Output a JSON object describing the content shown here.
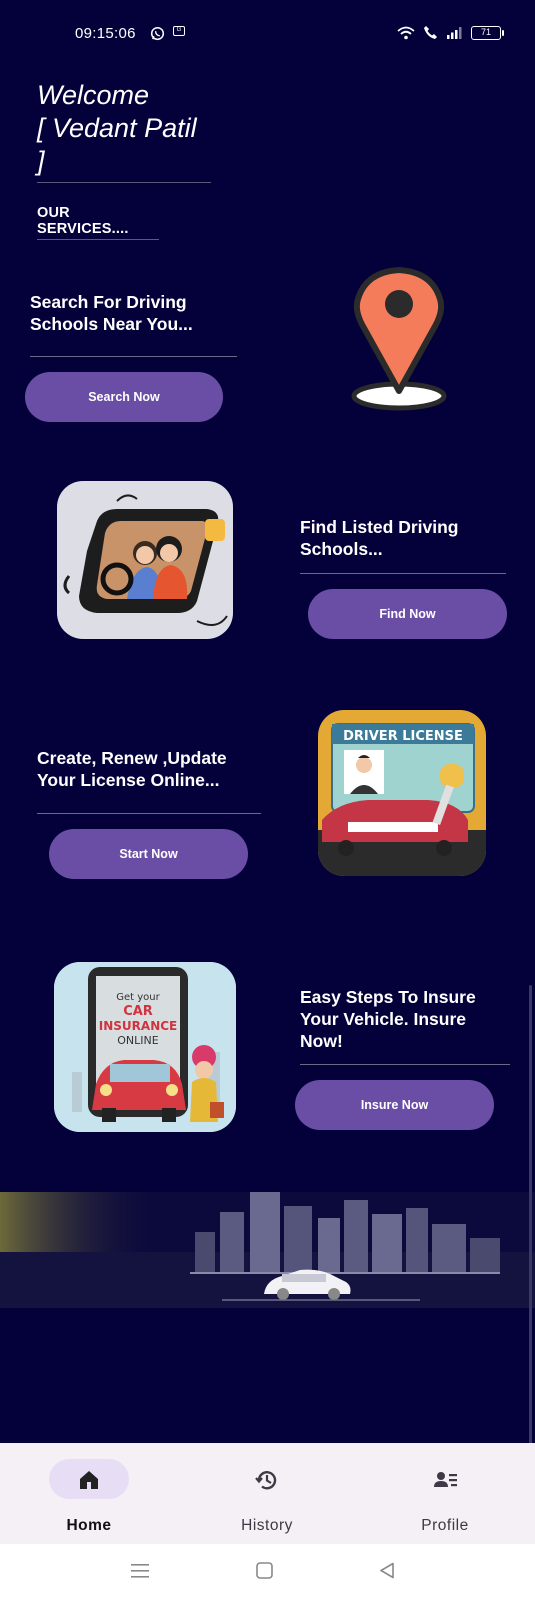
{
  "status_bar": {
    "time": "09:15:06",
    "battery": "71"
  },
  "welcome": {
    "line1": "Welcome",
    "line2": "[ Vedant Patil ]"
  },
  "services_title": "OUR SERVICES....",
  "services": [
    {
      "text": "Search For Driving Schools Near You...",
      "button": "Search Now",
      "image_icon": "location-pin-icon"
    },
    {
      "text": "Find Listed Driving Schools...",
      "button": "Find Now",
      "image_icon": "driving-lesson-illustration"
    },
    {
      "text": "Create, Renew ,Update Your License Online...",
      "button": "Start Now",
      "image_icon": "driver-license-illustration",
      "image_caption": "DRIVER LICENSE"
    },
    {
      "text": "Easy Steps To Insure Your Vehicle. Insure Now!",
      "button": "Insure Now",
      "image_icon": "car-insurance-illustration",
      "image_caption": [
        "Get your",
        "CAR",
        "INSURANCE",
        "ONLINE"
      ]
    }
  ],
  "bottom_nav": [
    {
      "label": "Home",
      "icon": "home-icon",
      "active": true
    },
    {
      "label": "History",
      "icon": "history-icon",
      "active": false
    },
    {
      "label": "Profile",
      "icon": "profile-icon",
      "active": false
    }
  ],
  "colors": {
    "background": "#04013a",
    "button": "#6a4ea6",
    "pin": "#f47c5a",
    "nav_bg": "#f5eff6",
    "nav_active": "#e7def6"
  }
}
